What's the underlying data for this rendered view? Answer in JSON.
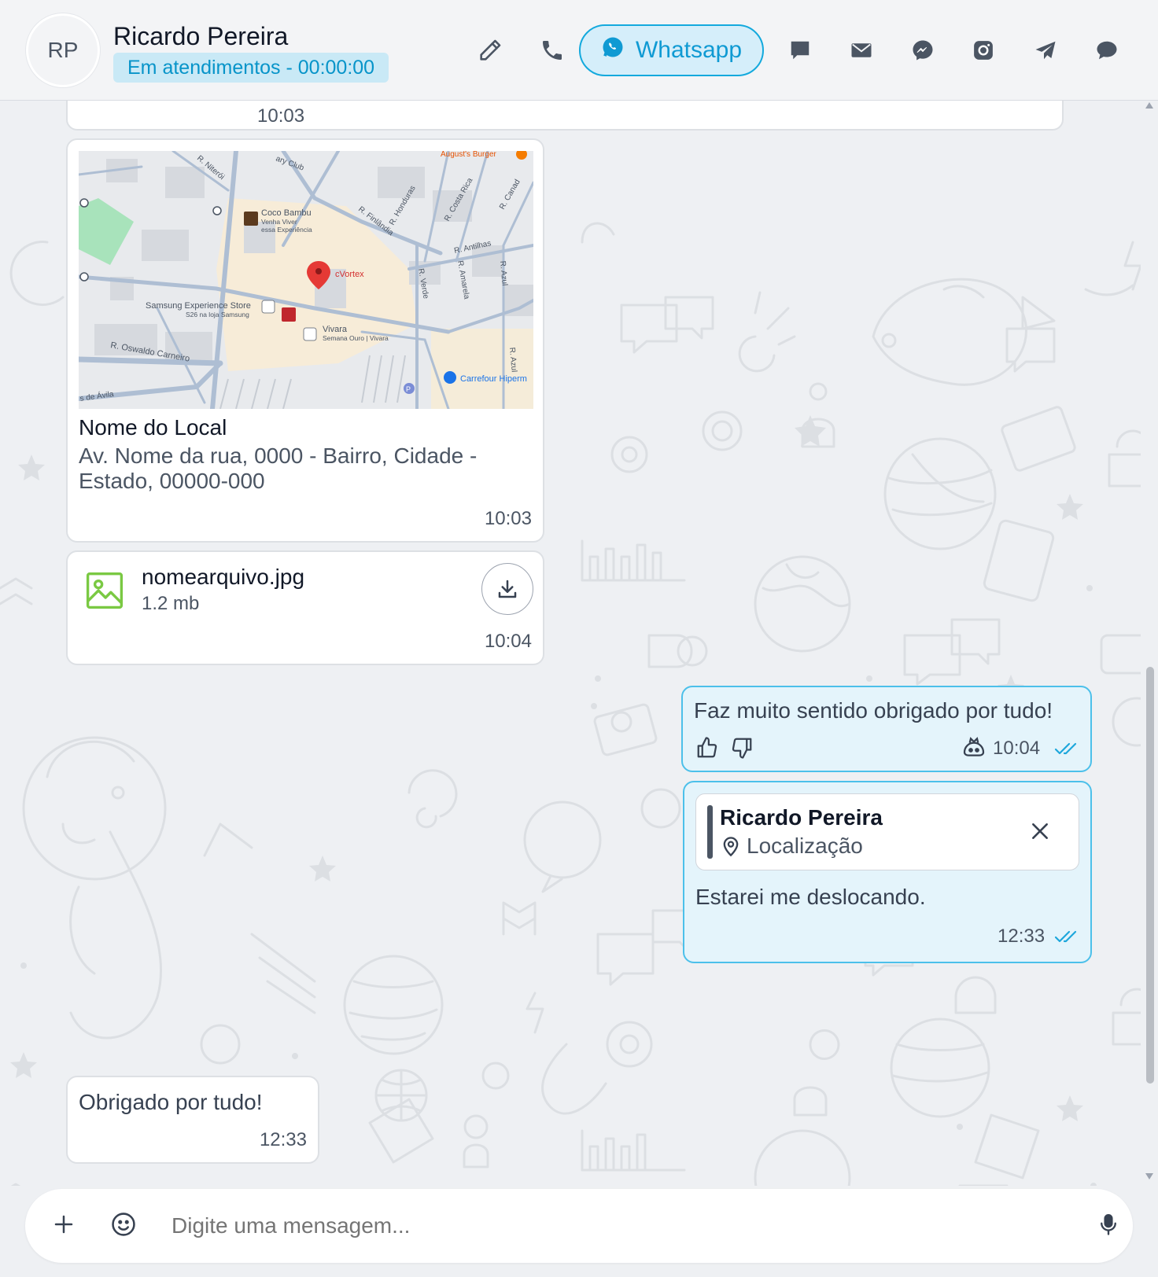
{
  "header": {
    "avatar_initials": "RP",
    "contact_name": "Ricardo Pereira",
    "status": "Em atendimentos - 00:00:00",
    "channel_label": "Whatsapp",
    "icons": [
      "pencil-icon",
      "phone-icon",
      "whatsapp-icon",
      "chat-icon",
      "mail-icon",
      "messenger-icon",
      "instagram-icon",
      "telegram-icon",
      "comments-icon"
    ],
    "accent_color": "#13a9dd"
  },
  "messages": {
    "partial_time": "10:03",
    "location": {
      "map": {
        "pin_label": "cVortex",
        "labels": {
          "coco_bambu": "Coco Bambu",
          "coco_sub1": "Venha Viver",
          "coco_sub2": "essa Experiência",
          "samsung": "Samsung Experience Store",
          "samsung_sub": "S26 na loja Samsung",
          "vivara": "Vivara",
          "vivara_sub": "Semana Ouro | Vivara",
          "carrefour": "Carrefour Hiperm",
          "augusts": "August's Burger",
          "club": "ary Club",
          "niteroi": "R. Niterói",
          "finlandia": "R. Finlândia",
          "honduras": "R. Honduras",
          "costa_rica": "R. Costa Rica",
          "canada": "R. Canad",
          "antilhas": "R. Antilhas",
          "verde": "R. Verde",
          "amarela": "R. Amarela",
          "azul": "R. Azul",
          "azul2": "R. Azul",
          "oswaldo": "R. Oswaldo Carneiro",
          "avila": "s de Ávila",
          "parking": "P"
        }
      },
      "title": "Nome do Local",
      "address_line1": "Av. Nome da rua, 0000 - Bairro, Cidade -",
      "address_line2": "Estado, 00000-000",
      "time": "10:03"
    },
    "file": {
      "name": "nomearquivo.jpg",
      "size": "1.2 mb",
      "time": "10:04"
    },
    "outgoing1": {
      "text": "Faz muito sentido obrigado por tudo!",
      "time": "10:04"
    },
    "outgoing2": {
      "reply_author": "Ricardo Pereira",
      "reply_type": "Localização",
      "text": "Estarei me deslocando.",
      "time": "12:33"
    },
    "incoming_last": {
      "text": "Obrigado por tudo!",
      "time": "12:33"
    }
  },
  "composer": {
    "placeholder": "Digite uma mensagem..."
  }
}
